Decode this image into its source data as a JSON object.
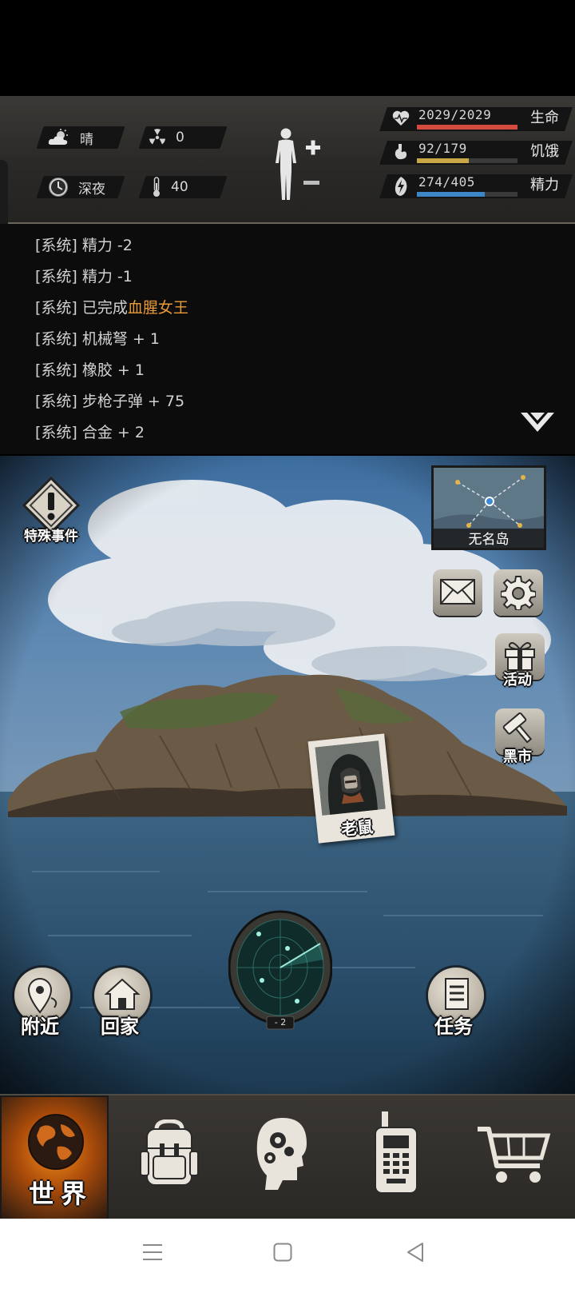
{
  "status": {
    "weather": {
      "icon": "cloud-sun-icon",
      "label": "晴"
    },
    "radiation": {
      "icon": "radiation-icon",
      "value": "0"
    },
    "time": {
      "icon": "clock-icon",
      "label": "深夜"
    },
    "temperature": {
      "icon": "thermometer-icon",
      "value": "40"
    },
    "body": {
      "icon": "body-figure-icon"
    },
    "stats": [
      {
        "label": "生命",
        "value": "2029/2029",
        "fraction": 1.0,
        "color": "#d24b3e",
        "icon": "heart-icon"
      },
      {
        "label": "饥饿",
        "value": "92/179",
        "fraction": 0.514,
        "color": "#c9a646",
        "icon": "stomach-icon"
      },
      {
        "label": "精力",
        "value": "274/405",
        "fraction": 0.677,
        "color": "#3d86c8",
        "icon": "energy-icon"
      }
    ]
  },
  "log": {
    "lines": [
      {
        "prefix": "[系统]",
        "text": "精力 -2",
        "highlight": ""
      },
      {
        "prefix": "[系统]",
        "text": "精力 -1",
        "highlight": ""
      },
      {
        "prefix": "[系统]",
        "text": "已完成",
        "highlight": "血腥女王"
      },
      {
        "prefix": "[系统]",
        "text": "机械弩 + 1",
        "highlight": ""
      },
      {
        "prefix": "[系统]",
        "text": "橡胶 + 1",
        "highlight": ""
      },
      {
        "prefix": "[系统]",
        "text": "步枪子弹 + 75",
        "highlight": ""
      },
      {
        "prefix": "[系统]",
        "text": "合金 + 2",
        "highlight": ""
      }
    ]
  },
  "scene": {
    "special_event": "特殊事件",
    "minimap_label": "无名岛",
    "side_buttons": {
      "activity": "活动",
      "black_market": "黑市"
    },
    "npc": {
      "name": "老鼠"
    },
    "radar_badge": "- 2",
    "bottom_buttons": {
      "nearby": "附近",
      "home": "回家",
      "quest": "任务"
    }
  },
  "tabs": [
    {
      "label": "世界",
      "icon": "globe-icon",
      "active": true
    },
    {
      "label": "",
      "icon": "backpack-icon",
      "active": false
    },
    {
      "label": "",
      "icon": "head-gears-icon",
      "active": false
    },
    {
      "label": "",
      "icon": "walkie-talkie-icon",
      "active": false
    },
    {
      "label": "",
      "icon": "shopping-cart-icon",
      "active": false
    }
  ]
}
